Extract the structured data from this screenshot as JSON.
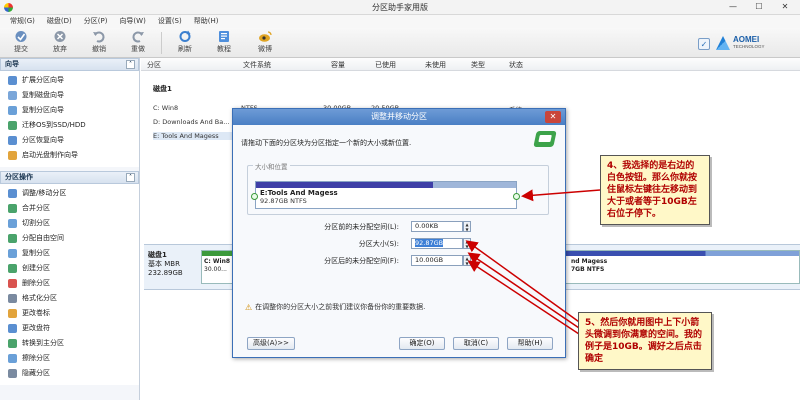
{
  "window": {
    "title": "分区助手家用版",
    "buttons": [
      "—",
      "☐",
      "✕"
    ]
  },
  "menu": [
    "常规(G)",
    "磁盘(D)",
    "分区(P)",
    "向导(W)",
    "设置(S)",
    "帮助(H)"
  ],
  "toolbar": {
    "items": [
      {
        "label": "提交",
        "icon": "commit-icon"
      },
      {
        "label": "放弃",
        "icon": "discard-icon"
      },
      {
        "label": "撤销",
        "icon": "undo-icon"
      },
      {
        "label": "重做",
        "icon": "redo-icon"
      },
      {
        "label": "刷新",
        "icon": "refresh-icon"
      },
      {
        "label": "教程",
        "icon": "tutorial-icon"
      },
      {
        "label": "微博",
        "icon": "weibo-icon"
      }
    ],
    "brand": {
      "name": "AOMEI",
      "sub": "TECHNOLOGY"
    }
  },
  "sidebar": {
    "wizard": {
      "title": "向导",
      "items": [
        "扩展分区向导",
        "复制磁盘向导",
        "复制分区向导",
        "迁移OS到SSD/HDD",
        "分区恢复向导",
        "启动光盘制作向导"
      ]
    },
    "ops": {
      "title": "分区操作",
      "items": [
        "调整/移动分区",
        "合并分区",
        "切割分区",
        "分配自由空间",
        "复制分区",
        "创建分区",
        "删除分区",
        "格式化分区",
        "更改卷标",
        "更改盘符",
        "转换到主分区",
        "擦除分区",
        "隐藏分区"
      ]
    }
  },
  "table": {
    "headers": [
      "分区",
      "文件系统",
      "容量",
      "已使用",
      "未使用",
      "类型",
      "状态"
    ],
    "disk_label": "磁盘1",
    "rows": [
      "C: Win8",
      "D: Downloads And Ba...",
      "E: Tools And Magess"
    ],
    "row_fragments": [
      "NTFS",
      "30.00GB",
      "20.50GB",
      "系统"
    ]
  },
  "disk_map": {
    "name": "磁盘1",
    "type": "基本 MBR",
    "size": "232.89GB",
    "part1": {
      "name": "C: Win8",
      "info": "30.00..."
    },
    "part2": {
      "name": "nd Magess",
      "info": "7GB NTFS"
    }
  },
  "dialog": {
    "title": "调整并移动分区",
    "instruction": "请拖动下面的分区块为分区指定一个新的大小或新位置.",
    "group_label": "大小和位置",
    "partition": {
      "name": "E:Tools And Magess",
      "info": "92.87GB NTFS",
      "used_fraction": 0.68
    },
    "fields": [
      {
        "label": "分区前的未分配空间(L):",
        "value": "0.00KB"
      },
      {
        "label": "分区大小(S):",
        "value": "92.87GB"
      },
      {
        "label": "分区后的未分配空间(F):",
        "value": "10.00GB"
      }
    ],
    "warning": "在调整你的分区大小之前我们建议你备份你的重要数据.",
    "buttons": {
      "advanced": "高级(A)>>",
      "ok": "确定(O)",
      "cancel": "取消(C)",
      "help": "帮助(H)"
    }
  },
  "callouts": {
    "top": "4、我选择的是右边的白色按钮。那么你就按住鼠标左键往左移动到大于或者等于10GB左右位子停下。",
    "bottom": "5、然后你就用图中上下小箭头微调到你满意的空间。我的例子是10GB。调好之后点击确定"
  },
  "colors": {
    "annotation": "#b00000",
    "arrow": "#cc0000",
    "accent": "#4a7fc4"
  }
}
